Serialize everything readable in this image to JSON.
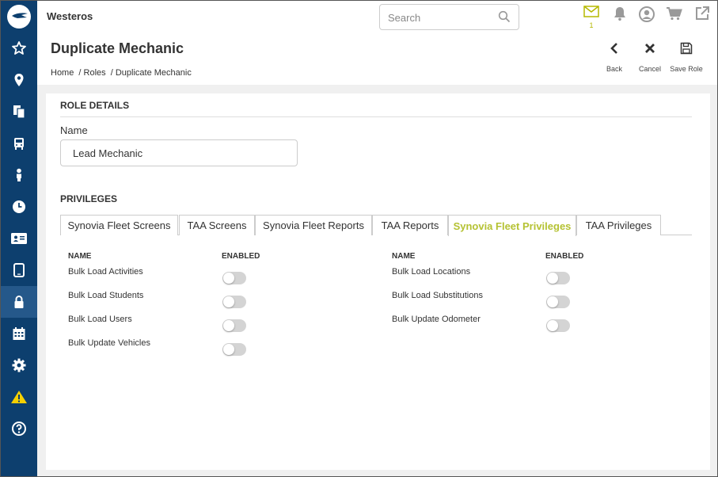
{
  "app": {
    "title": "Westeros"
  },
  "search": {
    "placeholder": "Search"
  },
  "notifications": {
    "mail_count": "1"
  },
  "page": {
    "title": "Duplicate Mechanic",
    "breadcrumb": [
      "Home",
      "/ Roles",
      "/ Duplicate Mechanic"
    ]
  },
  "actions": {
    "back": "Back",
    "cancel": "Cancel",
    "save": "Save Role"
  },
  "role_details": {
    "section_title": "ROLE DETAILS",
    "name_label": "Name",
    "name_value": "Lead Mechanic"
  },
  "privileges": {
    "section_title": "PRIVILEGES",
    "tabs": [
      {
        "label": "Synovia Fleet Screens",
        "active": false
      },
      {
        "label": "TAA Screens",
        "active": false
      },
      {
        "label": "Synovia Fleet Reports",
        "active": false
      },
      {
        "label": "TAA Reports",
        "active": false
      },
      {
        "label": "Synovia Fleet Privileges",
        "active": true
      },
      {
        "label": "TAA Privileges",
        "active": false
      }
    ],
    "columns": {
      "name": "NAME",
      "enabled": "ENABLED"
    },
    "left_items": [
      {
        "name": "Bulk Load Activities",
        "enabled": false
      },
      {
        "name": "Bulk Load Students",
        "enabled": false
      },
      {
        "name": "Bulk Load Users",
        "enabled": false
      },
      {
        "name": "Bulk Update Vehicles",
        "enabled": false
      }
    ],
    "right_items": [
      {
        "name": "Bulk Load Locations",
        "enabled": false
      },
      {
        "name": "Bulk Load Substitutions",
        "enabled": false
      },
      {
        "name": "Bulk Update Odometer",
        "enabled": false
      }
    ]
  },
  "sidebar": {
    "icons": [
      "star-icon",
      "location-pin-icon",
      "documents-icon",
      "bus-icon",
      "person-icon",
      "clock-icon",
      "id-card-icon",
      "tablet-icon",
      "lock-icon",
      "calendar-icon",
      "gear-icon",
      "warning-icon",
      "help-icon"
    ],
    "active": "lock-icon"
  },
  "colors": {
    "sidebar": "#0d3f6e",
    "sidebar_active": "#25588a",
    "accent": "#b5c233",
    "warning": "#f5d000",
    "top_icons": "#9a9a9a"
  }
}
